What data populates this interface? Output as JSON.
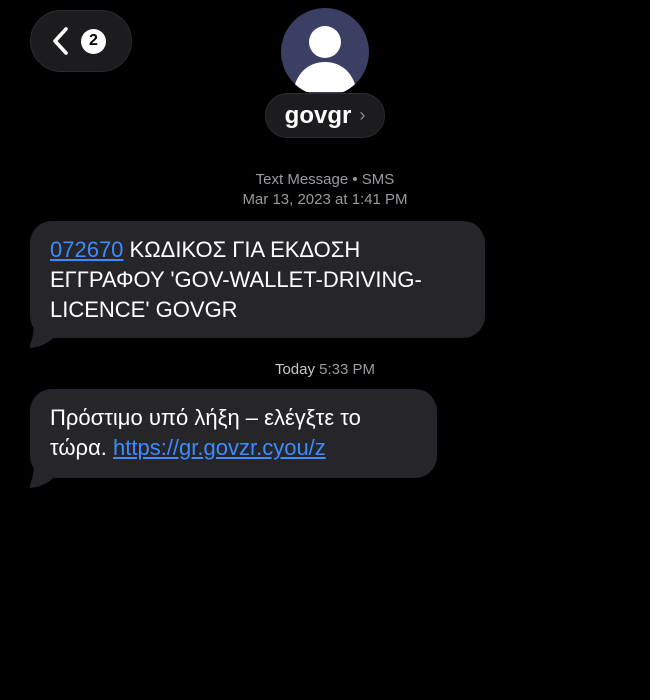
{
  "nav": {
    "unread_count": "2"
  },
  "contact": {
    "name": "govgr",
    "chevron": "›"
  },
  "thread": {
    "first_header": {
      "service": "Text Message • SMS",
      "date": "Mar 13, 2023 at",
      "time": "1:41 PM"
    },
    "message1": {
      "code": "072670",
      "line1_rest": " ΚΩΔΙΚΟΣ ΓΙΑ ΕΚΔΟΣΗ",
      "line2": "ΕΓΓΡΑΦΟΥ 'GOV-WALLET-DRIVING-",
      "line3": "LICENCE' GOVGR"
    },
    "second_header": {
      "day": "Today",
      "time": "5:33 PM"
    },
    "message2": {
      "line1": "Πρόστιμο υπό λήξη – ελέγξτε το",
      "line2_prefix": "τώρα. ",
      "link": "https://gr.govzr.cyou/z"
    }
  },
  "colors": {
    "background": "#000000",
    "bubble": "#26252a",
    "link": "#3b8cff",
    "avatar": "#3a3f63"
  },
  "icons": [
    "back-chevron-icon",
    "person-icon",
    "chevron-right-icon"
  ]
}
